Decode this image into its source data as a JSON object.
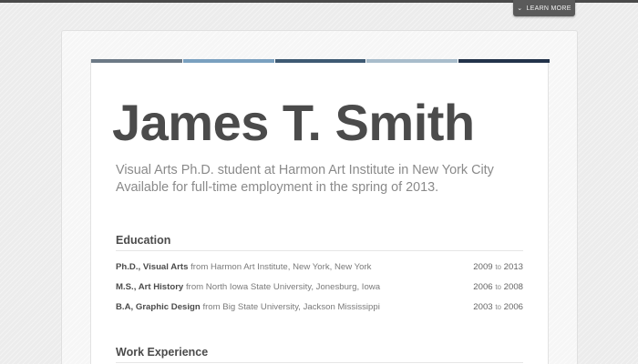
{
  "top_button": {
    "label": "LEARN MORE",
    "icon": "chevron-down-icon"
  },
  "colors": {
    "strip": [
      "#6c7986",
      "#7aa0bf",
      "#3e5a73",
      "#a8bccb",
      "#23334a"
    ],
    "name": "#4b4b4b",
    "summary": "#8a8a8a"
  },
  "resume": {
    "name": "James T. Smith",
    "summary_line1": "Visual Arts Ph.D. student at Harmon Art Institute in New York City",
    "summary_line2": "Available for full-time employment in the spring of 2013."
  },
  "education": {
    "title": "Education",
    "items": [
      {
        "degree": "Ph.D., Visual Arts",
        "place": "from Harmon Art Institute, New York, New York",
        "start": "2009",
        "sep": "to",
        "end": "2013"
      },
      {
        "degree": "M.S., Art History",
        "place": "from North Iowa State University, Jonesburg, Iowa",
        "start": "2006",
        "sep": "to",
        "end": "2008"
      },
      {
        "degree": "B.A, Graphic Design",
        "place": "from Big State University, Jackson Mississippi",
        "start": "2003",
        "sep": "to",
        "end": "2006"
      }
    ]
  },
  "work": {
    "title": "Work Experience"
  }
}
